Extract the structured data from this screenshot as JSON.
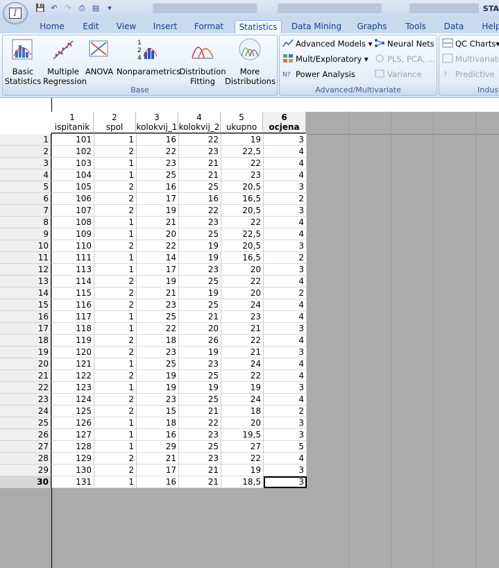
{
  "window": {
    "title_fragment": "STA"
  },
  "tabs": [
    "Home",
    "Edit",
    "View",
    "Insert",
    "Format",
    "Statistics",
    "Data Mining",
    "Graphs",
    "Tools",
    "Data",
    "Help"
  ],
  "active_tab": "Statistics",
  "ribbon": {
    "base": {
      "label": "Base",
      "buttons": [
        {
          "l1": "Basic",
          "l2": "Statistics",
          "icon": "basic-statistics-icon"
        },
        {
          "l1": "Multiple",
          "l2": "Regression",
          "icon": "multiple-regression-icon"
        },
        {
          "l1": "ANOVA",
          "l2": "",
          "icon": "anova-icon"
        },
        {
          "l1": "Nonparametrics",
          "l2": "",
          "icon": "nonparametrics-icon"
        },
        {
          "l1": "Distribution",
          "l2": "Fitting",
          "icon": "distribution-fitting-icon"
        },
        {
          "l1": "More",
          "l2": "Distributions",
          "icon": "more-distributions-icon"
        }
      ]
    },
    "advanced": {
      "label": "Advanced/Multivariate",
      "advanced_models": "Advanced Models",
      "neural_nets": "Neural Nets",
      "mult_exploratory": "Mult/Exploratory",
      "pls_pca": "PLS, PCA, ...",
      "power_analysis": "Power Analysis",
      "variance": "Variance"
    },
    "industrial": {
      "label": "Indust",
      "qc_charts": "QC Charts",
      "multivariate": "Multivariate",
      "predictive": "Predictive"
    }
  },
  "sheet": {
    "columns": [
      {
        "num": "1",
        "name": "ispitanik"
      },
      {
        "num": "2",
        "name": "spol"
      },
      {
        "num": "3",
        "name": "kolokvij_1"
      },
      {
        "num": "4",
        "name": "kolokvij_2"
      },
      {
        "num": "5",
        "name": "ukupno"
      },
      {
        "num": "6",
        "name": "ocjena"
      }
    ],
    "rows": [
      [
        "101",
        "1",
        "16",
        "22",
        "19",
        "3"
      ],
      [
        "102",
        "2",
        "22",
        "23",
        "22,5",
        "4"
      ],
      [
        "103",
        "1",
        "23",
        "21",
        "22",
        "4"
      ],
      [
        "104",
        "1",
        "25",
        "21",
        "23",
        "4"
      ],
      [
        "105",
        "2",
        "16",
        "25",
        "20,5",
        "3"
      ],
      [
        "106",
        "2",
        "17",
        "16",
        "16,5",
        "2"
      ],
      [
        "107",
        "2",
        "19",
        "22",
        "20,5",
        "3"
      ],
      [
        "108",
        "1",
        "21",
        "23",
        "22",
        "4"
      ],
      [
        "109",
        "1",
        "20",
        "25",
        "22,5",
        "4"
      ],
      [
        "110",
        "2",
        "22",
        "19",
        "20,5",
        "3"
      ],
      [
        "111",
        "1",
        "14",
        "19",
        "16,5",
        "2"
      ],
      [
        "113",
        "1",
        "17",
        "23",
        "20",
        "3"
      ],
      [
        "114",
        "2",
        "19",
        "25",
        "22",
        "4"
      ],
      [
        "115",
        "2",
        "21",
        "19",
        "20",
        "2"
      ],
      [
        "116",
        "2",
        "23",
        "25",
        "24",
        "4"
      ],
      [
        "117",
        "1",
        "25",
        "21",
        "23",
        "4"
      ],
      [
        "118",
        "1",
        "22",
        "20",
        "21",
        "3"
      ],
      [
        "119",
        "2",
        "18",
        "26",
        "22",
        "4"
      ],
      [
        "120",
        "2",
        "23",
        "19",
        "21",
        "3"
      ],
      [
        "121",
        "1",
        "25",
        "23",
        "24",
        "4"
      ],
      [
        "122",
        "2",
        "19",
        "25",
        "22",
        "4"
      ],
      [
        "123",
        "1",
        "19",
        "19",
        "19",
        "3"
      ],
      [
        "124",
        "2",
        "23",
        "25",
        "24",
        "4"
      ],
      [
        "125",
        "2",
        "15",
        "21",
        "18",
        "2"
      ],
      [
        "126",
        "1",
        "18",
        "22",
        "20",
        "3"
      ],
      [
        "127",
        "1",
        "16",
        "23",
        "19,5",
        "3"
      ],
      [
        "128",
        "1",
        "29",
        "25",
        "27",
        "5"
      ],
      [
        "129",
        "2",
        "21",
        "23",
        "22",
        "4"
      ],
      [
        "130",
        "2",
        "17",
        "21",
        "19",
        "3"
      ],
      [
        "131",
        "1",
        "16",
        "21",
        "18,5",
        "3"
      ]
    ]
  }
}
